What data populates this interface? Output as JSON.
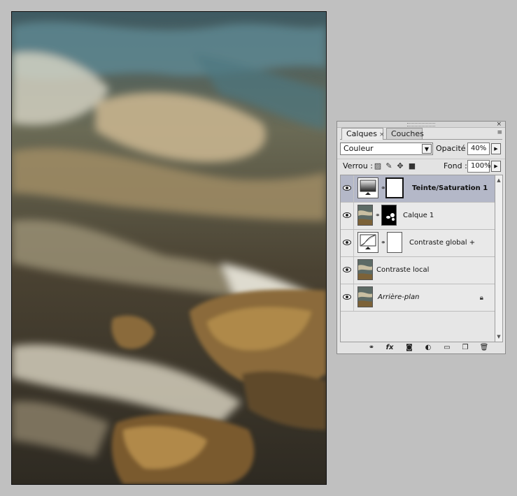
{
  "canvas": {
    "description_icon": "image-canvas"
  },
  "panel": {
    "tabs": [
      {
        "label": "Calques",
        "close": "×"
      },
      {
        "label": "Couches"
      }
    ],
    "panel_close": "×",
    "panel_menu_icon": "≡",
    "blend_mode": "Couleur",
    "opacity_label": "Opacité :",
    "opacity_value": "40%",
    "lock_label": "Verrou :",
    "fill_label": "Fond :",
    "fill_value": "100%",
    "layers": [
      {
        "name": "Teinte/Saturation 1",
        "selected": true,
        "thumb": "adjustment-hue-sat",
        "mask": "white-mask"
      },
      {
        "name": "Calque 1",
        "selected": false,
        "thumb": "photo",
        "mask": "black-mask"
      },
      {
        "name": "Contraste global +",
        "selected": false,
        "thumb": "adjustment-curves",
        "mask": "white-mask"
      },
      {
        "name": "Contraste local",
        "selected": false,
        "thumb": "photo"
      },
      {
        "name": "Arrière-plan",
        "selected": false,
        "thumb": "photo",
        "locked": true
      }
    ],
    "footer_icons": [
      "link-icon",
      "fx-icon",
      "mask-icon",
      "adjustment-icon",
      "group-folder-icon",
      "new-layer-icon",
      "trash-icon"
    ]
  }
}
